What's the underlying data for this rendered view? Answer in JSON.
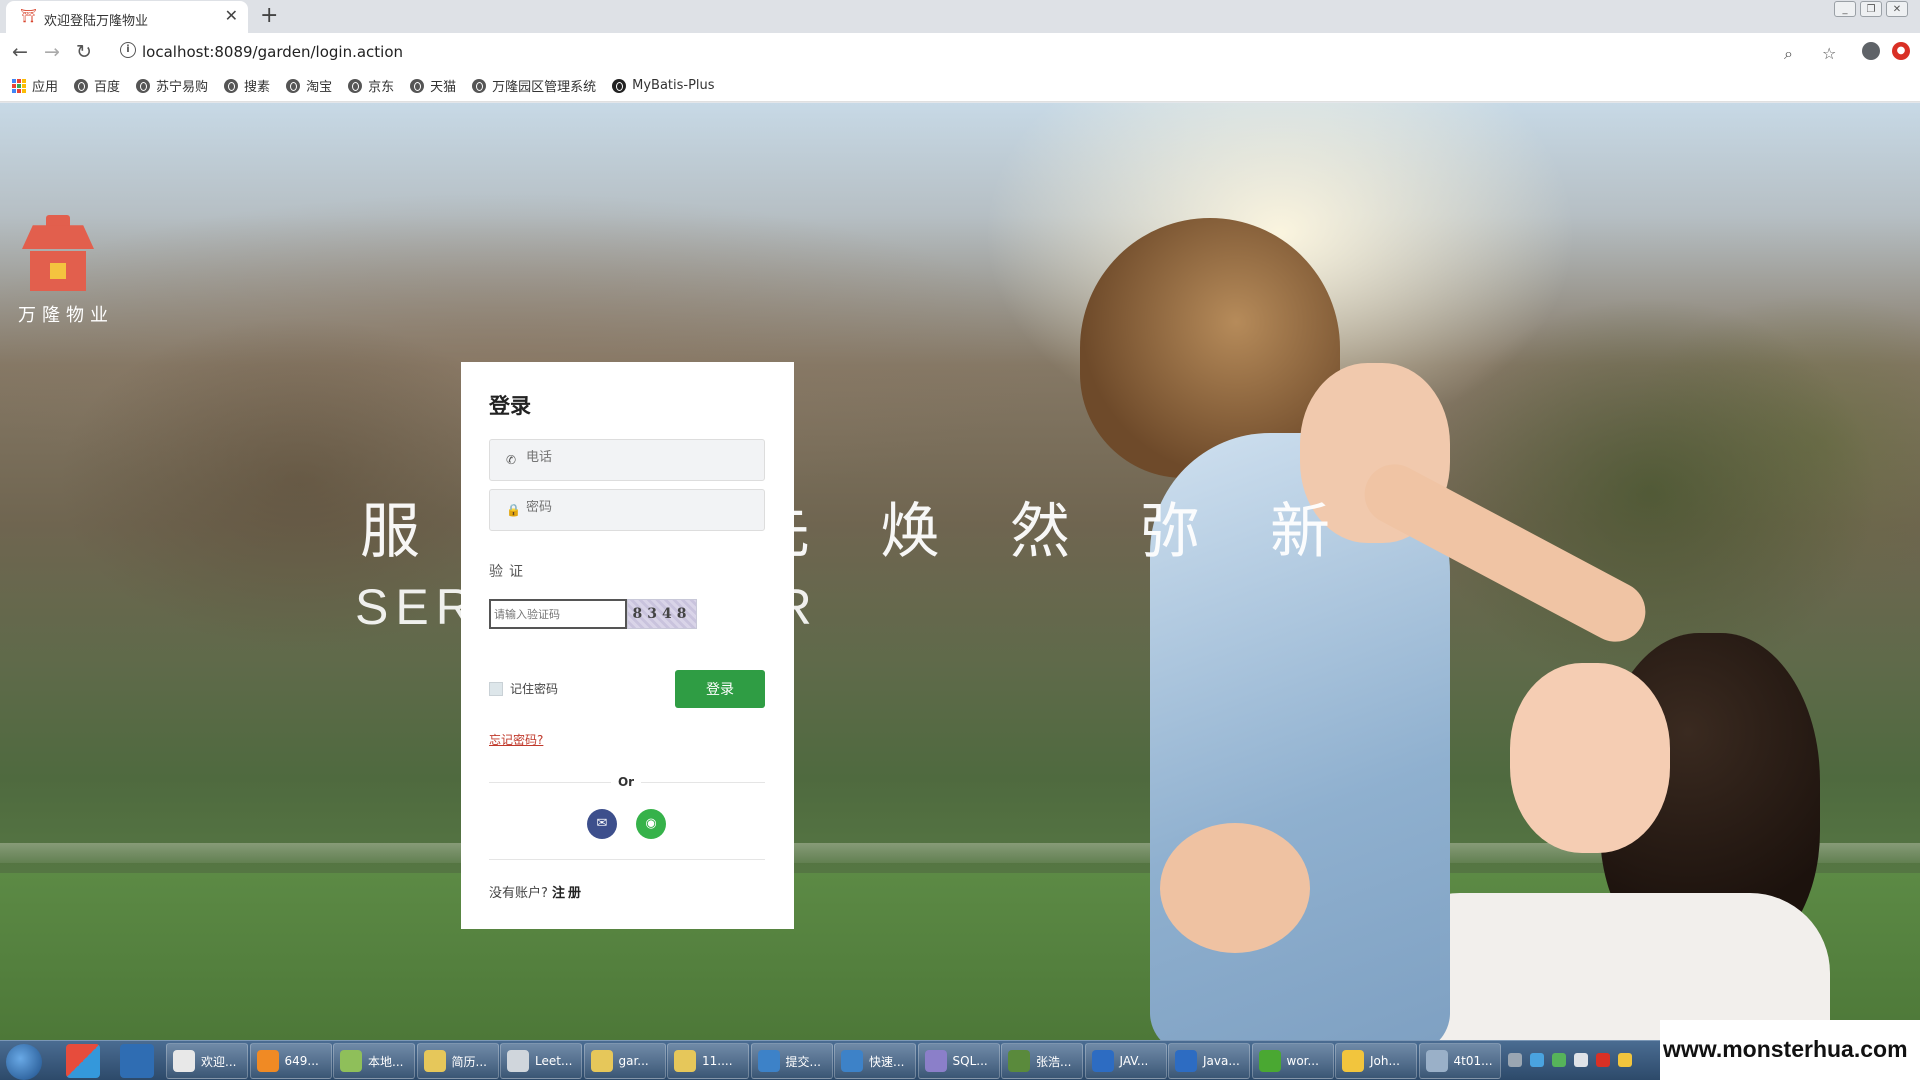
{
  "browser": {
    "tab_title": "欢迎登陆万隆物业",
    "tab_close": "✕",
    "new_tab": "+",
    "url": "localhost:8089/garden/login.action",
    "bookmarks": [
      "应用",
      "百度",
      "苏宁易购",
      "搜素",
      "淘宝",
      "京东",
      "天猫",
      "万隆园区管理系统",
      "MyBatis-Plus"
    ]
  },
  "logo": {
    "text": "万隆物业"
  },
  "slogan": {
    "cn": "服务领先焕然弥新",
    "en": "SERVE BETTER"
  },
  "login": {
    "title": "登录",
    "phone_placeholder": "电话",
    "password_placeholder": "密码",
    "verify_label": "验证",
    "captcha_placeholder": "请输入验证码",
    "captcha_code": "8348",
    "remember_label": "记住密码",
    "submit_label": "登录",
    "forgot_label": "忘记密码?",
    "or_label": "Or",
    "no_account": "没有账户?",
    "signup_label": "注册"
  },
  "taskbar": {
    "items": [
      "欢迎...",
      "649...",
      "本地...",
      "简历...",
      "Leet...",
      "gar...",
      "11....",
      "提交...",
      "快速...",
      "SQL...",
      "张浩...",
      "JAV...",
      "Java...",
      "wor...",
      "Joh...",
      "4t01..."
    ],
    "colors": [
      "#e8e8e8",
      "#f08a24",
      "#8fbf5a",
      "#e6c75a",
      "#d0d6dc",
      "#e6c75a",
      "#e6c75a",
      "#3d82c8",
      "#3d82c8",
      "#8b7fc9",
      "#5a8a3c",
      "#2d6cc2",
      "#2d6cc2",
      "#4aa832",
      "#f2c53d",
      "#9ab0c8"
    ]
  },
  "watermark": "www.monsterhua.com",
  "colors": {
    "accent_green": "#2f9d44",
    "logo_red": "#e25f4d",
    "link_red": "#c0392b"
  }
}
